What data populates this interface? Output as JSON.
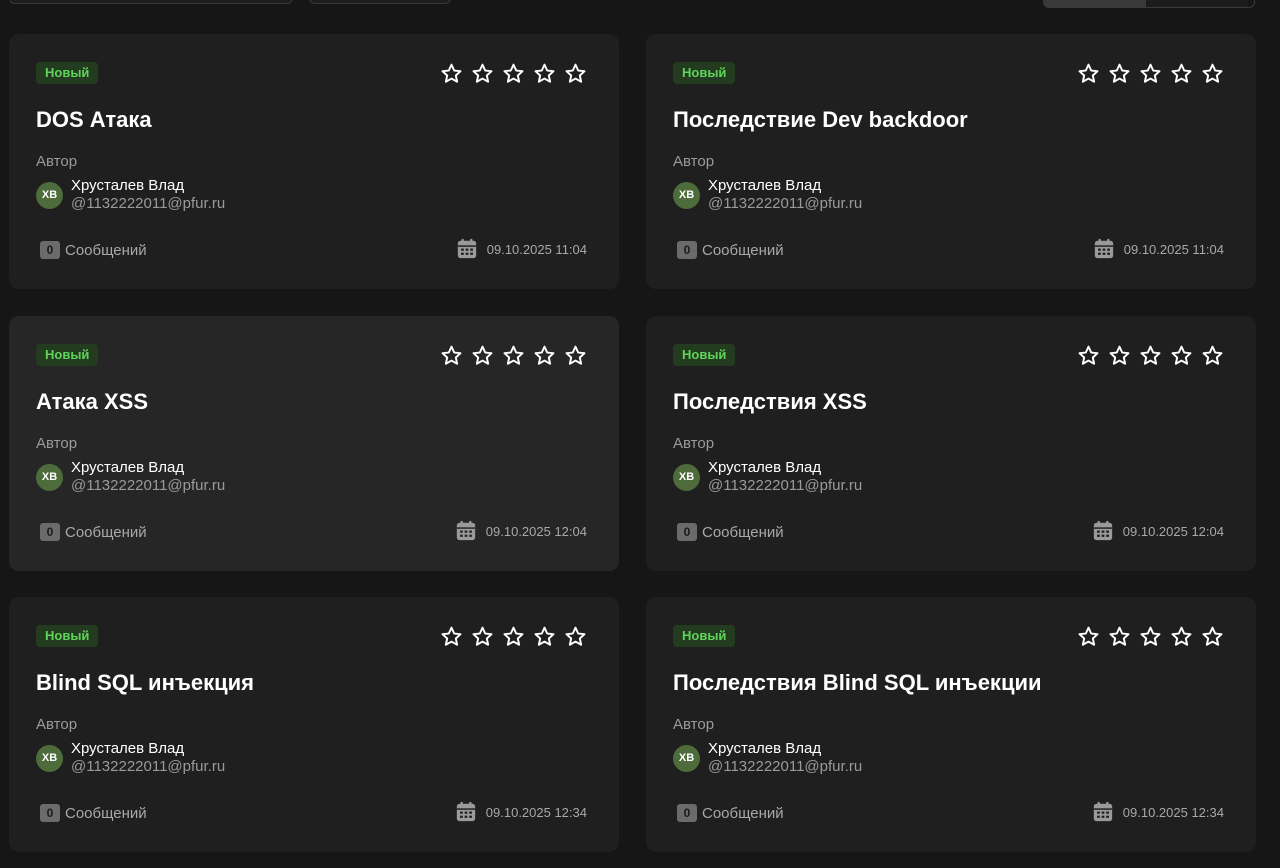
{
  "cards": [
    {
      "badge": "Новый",
      "title": "DOS Атака",
      "author_label": "Автор",
      "avatar_initials": "ХВ",
      "author_name": "Хрусталев Влад",
      "author_email": "@1132222011@pfur.ru",
      "messages_count": "0",
      "messages_label": "Сообщений",
      "date": "09.10.2025 11:04",
      "rating": 0,
      "rating_max": 5
    },
    {
      "badge": "Новый",
      "title": "Последствие Dev backdoor",
      "author_label": "Автор",
      "avatar_initials": "ХВ",
      "author_name": "Хрусталев Влад",
      "author_email": "@1132222011@pfur.ru",
      "messages_count": "0",
      "messages_label": "Сообщений",
      "date": "09.10.2025 11:04",
      "rating": 0,
      "rating_max": 5
    },
    {
      "badge": "Новый",
      "title": "Атака XSS",
      "author_label": "Автор",
      "avatar_initials": "ХВ",
      "author_name": "Хрусталев Влад",
      "author_email": "@1132222011@pfur.ru",
      "messages_count": "0",
      "messages_label": "Сообщений",
      "date": "09.10.2025 12:04",
      "rating": 0,
      "rating_max": 5
    },
    {
      "badge": "Новый",
      "title": "Последствия XSS",
      "author_label": "Автор",
      "avatar_initials": "ХВ",
      "author_name": "Хрусталев Влад",
      "author_email": "@1132222011@pfur.ru",
      "messages_count": "0",
      "messages_label": "Сообщений",
      "date": "09.10.2025 12:04",
      "rating": 0,
      "rating_max": 5
    },
    {
      "badge": "Новый",
      "title": "Blind SQL инъекция",
      "author_label": "Автор",
      "avatar_initials": "ХВ",
      "author_name": "Хрусталев Влад",
      "author_email": "@1132222011@pfur.ru",
      "messages_count": "0",
      "messages_label": "Сообщений",
      "date": "09.10.2025 12:34",
      "rating": 0,
      "rating_max": 5
    },
    {
      "badge": "Новый",
      "title": "Последствия Blind SQL инъекции",
      "author_label": "Автор",
      "avatar_initials": "ХВ",
      "author_name": "Хрусталев Влад",
      "author_email": "@1132222011@pfur.ru",
      "messages_count": "0",
      "messages_label": "Сообщений",
      "date": "09.10.2025 12:34",
      "rating": 0,
      "rating_max": 5
    }
  ],
  "icons": {
    "star": "star-outline-icon",
    "calendar": "calendar-icon"
  },
  "colors": {
    "page_background": "#161616",
    "card_background": "#1f1f1f",
    "card_hover_background": "#262626",
    "badge_background": "#233b1f",
    "badge_text": "#5fd35a",
    "avatar_background": "#4d6b3b"
  },
  "hovered_card_index": 2
}
